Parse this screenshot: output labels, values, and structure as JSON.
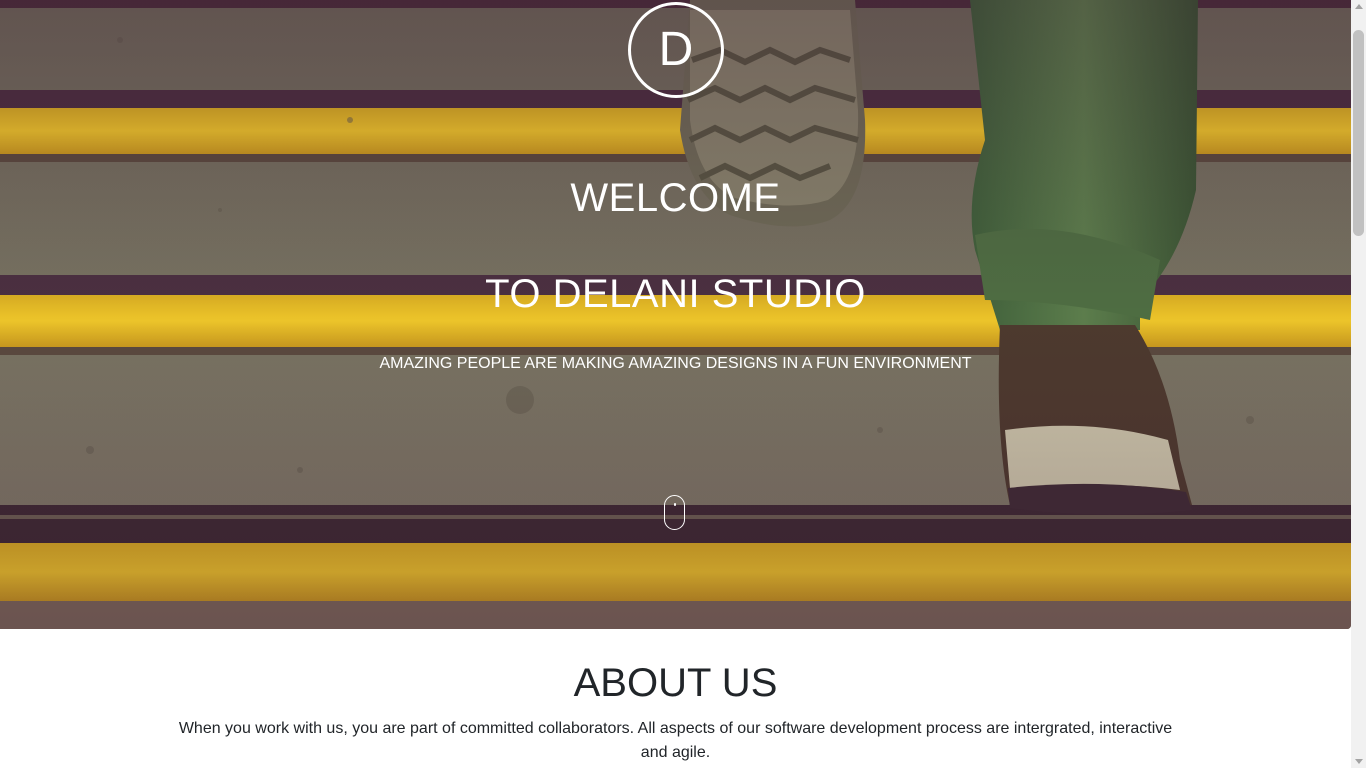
{
  "hero": {
    "logo_letter": "D",
    "title_line1": "WELCOME",
    "title_line2": "TO DELANI STUDIO",
    "subtitle": "AMAZING PEOPLE ARE MAKING AMAZING DESIGNS IN A FUN ENVIRONMENT",
    "scroll_icon": "mouse-icon"
  },
  "about": {
    "title": "ABOUT US",
    "text": "When you work with us, you are part of committed collaborators. All aspects of our software development process are intergrated, interactive and agile."
  },
  "colors": {
    "stripe_yellow": "#e2b824",
    "concrete": "#77715f",
    "text_dark": "#212529",
    "white": "#ffffff"
  }
}
